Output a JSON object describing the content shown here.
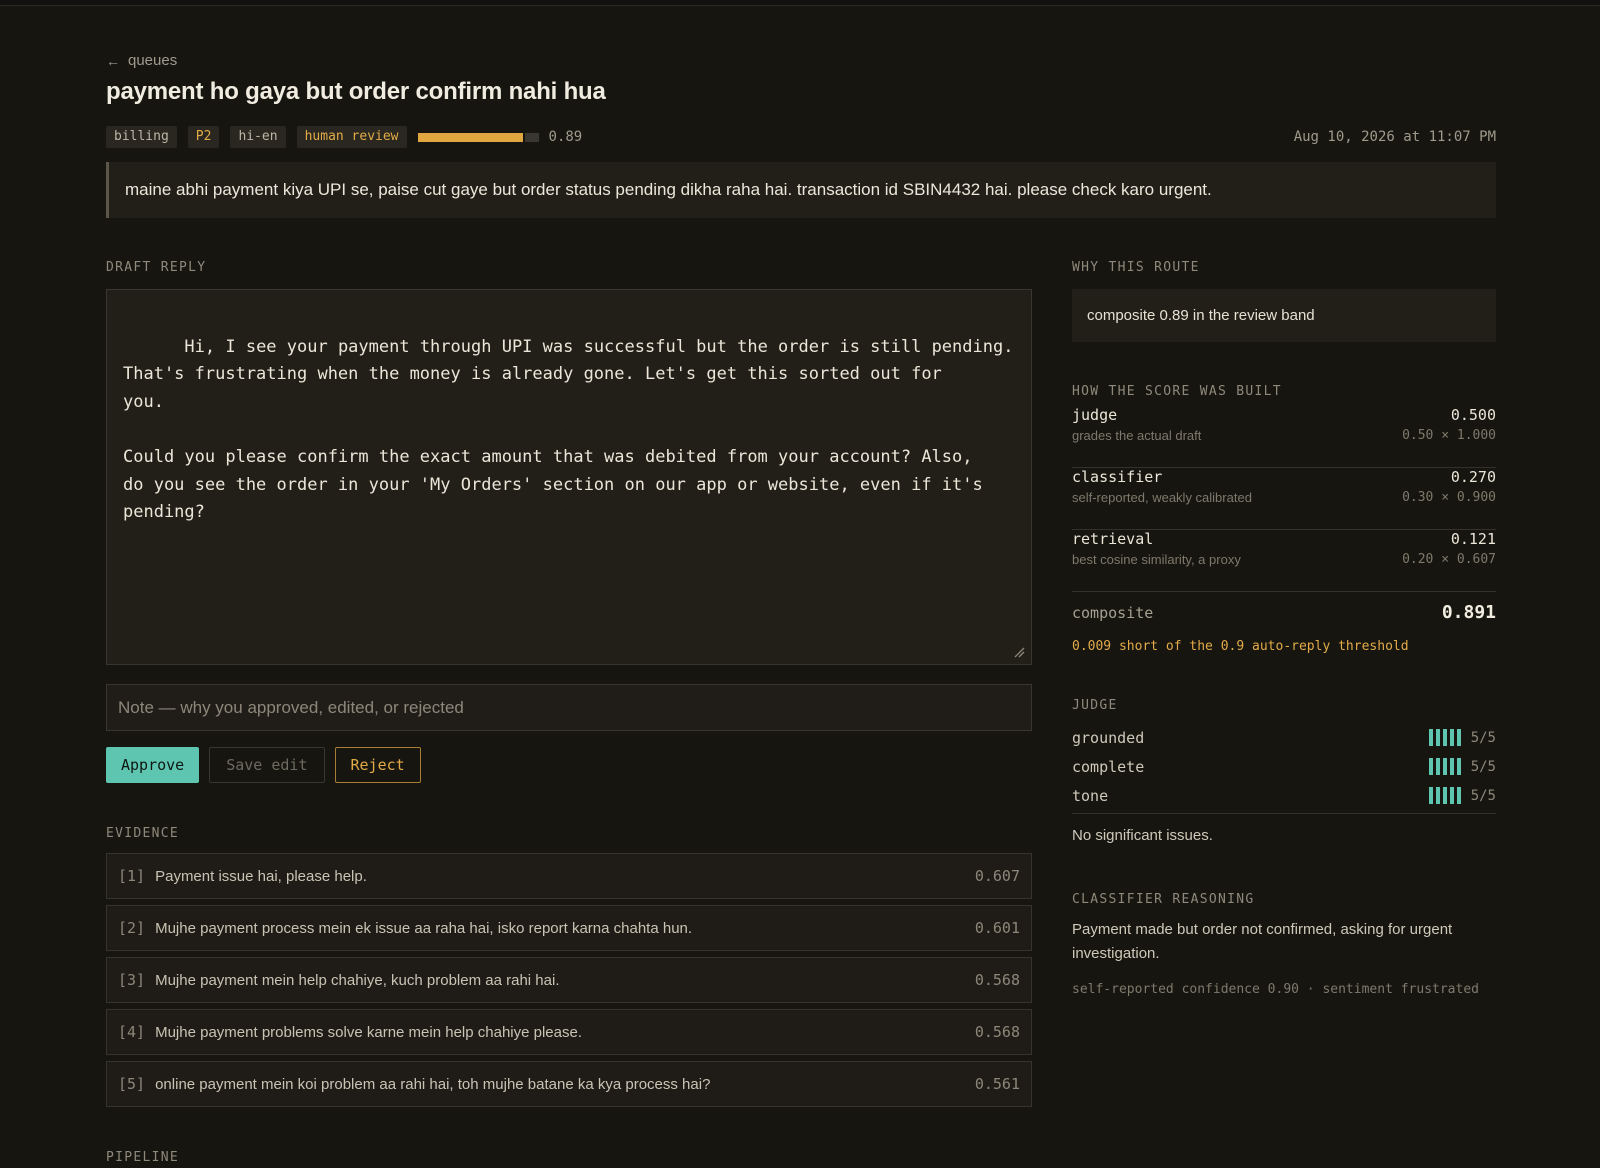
{
  "nav": {
    "back_label": "queues"
  },
  "ticket": {
    "title": "payment ho gaya but order confirm nahi hua",
    "tags": [
      "billing",
      "P2",
      "hi-en",
      "human review"
    ],
    "confidence": 0.89,
    "confidence_label": "0.89",
    "timestamp": "Aug 10, 2026 at 11:07 PM",
    "message": "maine abhi payment kiya UPI se, paise cut gaye but order status pending dikha raha hai. transaction id SBIN4432 hai. please check karo urgent."
  },
  "draft": {
    "section_label": "DRAFT REPLY",
    "text": "Hi, I see your payment through UPI was successful but the order is still pending.\nThat's frustrating when the money is already gone. Let's get this sorted out for\nyou.\n\nCould you please confirm the exact amount that was debited from your account? Also,\ndo you see the order in your 'My Orders' section on our app or website, even if it's\npending?",
    "note_placeholder": "Note — why you approved, edited, or rejected",
    "approve_label": "Approve",
    "save_label": "Save edit",
    "reject_label": "Reject"
  },
  "evidence": {
    "section_label": "EVIDENCE",
    "items": [
      {
        "index": "[1]",
        "text": "Payment issue hai, please help.",
        "score": "0.607"
      },
      {
        "index": "[2]",
        "text": "Mujhe payment process mein ek issue aa raha hai, isko report karna chahta hun.",
        "score": "0.601"
      },
      {
        "index": "[3]",
        "text": "Mujhe payment mein help chahiye, kuch problem aa rahi hai.",
        "score": "0.568"
      },
      {
        "index": "[4]",
        "text": "Mujhe payment problems solve karne mein help chahiye please.",
        "score": "0.568"
      },
      {
        "index": "[5]",
        "text": "online payment mein koi problem aa rahi hai, toh mujhe batane ka kya process hai?",
        "score": "0.561"
      }
    ]
  },
  "pipeline": {
    "section_label": "PIPELINE"
  },
  "route": {
    "section_label": "WHY THIS ROUTE",
    "reason": "composite 0.89 in the review band"
  },
  "score": {
    "section_label": "HOW THE SCORE WAS BUILT",
    "rows": [
      {
        "name": "judge",
        "desc": "grades the actual draft",
        "value": "0.500",
        "calc": "0.50 × 1.000"
      },
      {
        "name": "classifier",
        "desc": "self-reported, weakly calibrated",
        "value": "0.270",
        "calc": "0.30 × 0.900"
      },
      {
        "name": "retrieval",
        "desc": "best cosine similarity, a proxy",
        "value": "0.121",
        "calc": "0.20 × 0.607"
      }
    ],
    "composite_label": "composite",
    "composite_value": "0.891",
    "threshold_note": "0.009 short of the 0.9 auto-reply threshold"
  },
  "judge": {
    "section_label": "JUDGE",
    "rows": [
      {
        "name": "grounded",
        "score": "5/5",
        "level": 5
      },
      {
        "name": "complete",
        "score": "5/5",
        "level": 5
      },
      {
        "name": "tone",
        "score": "5/5",
        "level": 5
      }
    ],
    "note": "No significant issues."
  },
  "classifier": {
    "section_label": "CLASSIFIER REASONING",
    "reasoning": "Payment made but order not confirmed, asking for urgent investigation.",
    "meta": "self-reported confidence 0.90 · sentiment frustrated"
  },
  "colors": {
    "accent_teal": "#5ec6b0",
    "accent_amber": "#e3ab48",
    "background": "#161510"
  }
}
